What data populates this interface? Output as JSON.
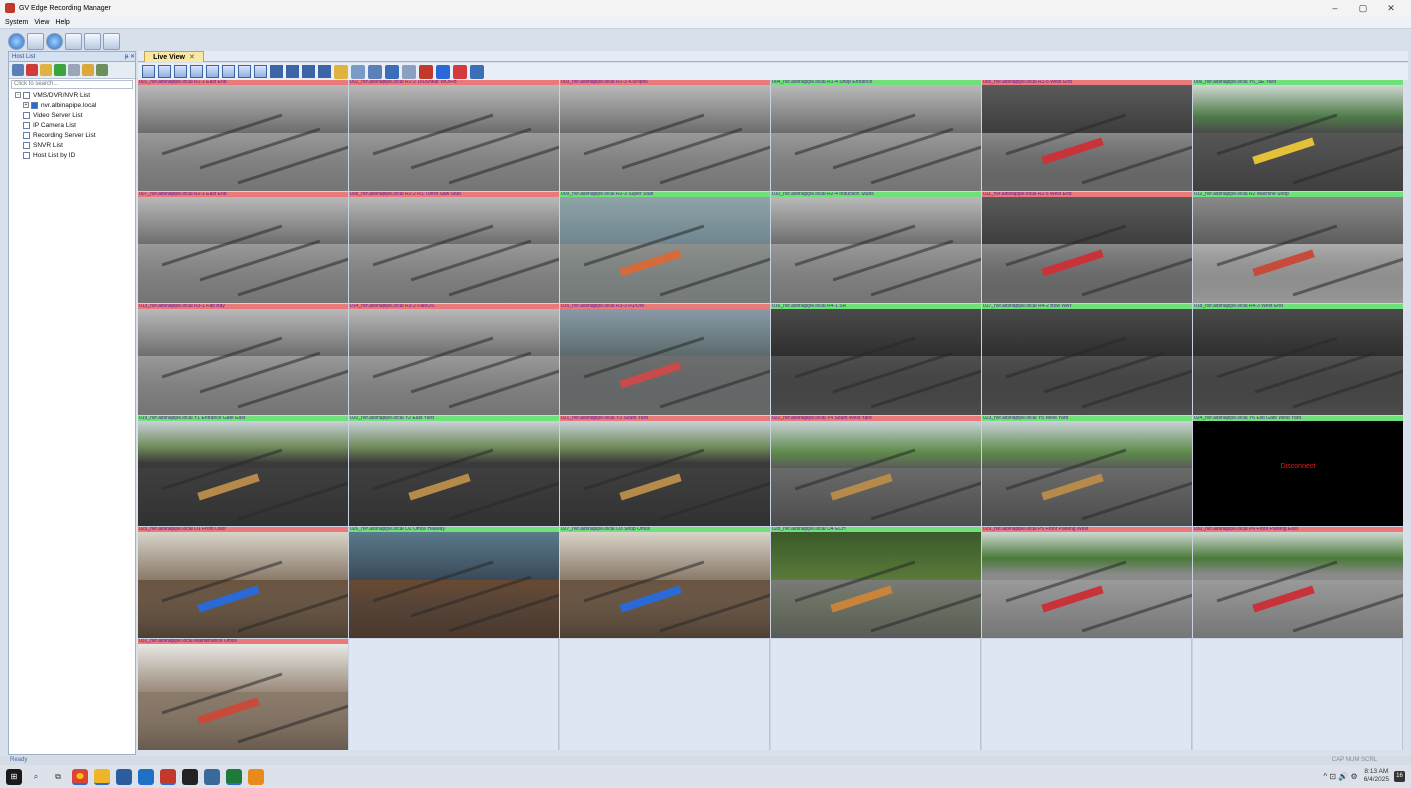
{
  "window": {
    "title": "GV Edge Recording Manager",
    "controls": [
      "–",
      "▢",
      "✕"
    ]
  },
  "menu": [
    {
      "label": "System"
    },
    {
      "label": "View"
    },
    {
      "label": "Help"
    }
  ],
  "host_panel": {
    "title": "Host List",
    "pin": "ᵽ ✕",
    "search_placeholder": "Click to search...",
    "tree": [
      {
        "label": "VMS/DVR/NVR List",
        "level": 0,
        "expand": "-"
      },
      {
        "label": "nvr.albinapipe.local",
        "level": 1,
        "expand": "+"
      },
      {
        "label": "Video Server List",
        "level": 0,
        "expand": ""
      },
      {
        "label": "IP Camera List",
        "level": 0,
        "expand": ""
      },
      {
        "label": "Recording Server List",
        "level": 0,
        "expand": ""
      },
      {
        "label": "SNVR List",
        "level": 0,
        "expand": ""
      },
      {
        "label": "Host List by ID",
        "level": 0,
        "expand": ""
      }
    ]
  },
  "tabs": {
    "live_view": "Live View",
    "close": "✕"
  },
  "cameras": [
    {
      "label": "001_nvr.albinapipe.local R1-1 East End",
      "status": "red",
      "scene": "gray"
    },
    {
      "label": "002_nvr.albinapipe.local R1-2 160Shear WO/FB",
      "status": "red",
      "scene": "gray"
    },
    {
      "label": "003_nvr.albinapipe.local R1-3 4.0Pipes",
      "status": "red",
      "scene": "gray"
    },
    {
      "label": "004_nvr.albinapipe.local R1-4 Shop Entrance",
      "status": "green",
      "scene": "gray"
    },
    {
      "label": "005_nvr.albinapipe.local R1-5 West End",
      "status": "red",
      "scene": "red"
    },
    {
      "label": "006_nvr.albinapipe.local Y6_SE Yard",
      "status": "green",
      "scene": "yard"
    },
    {
      "label": "007_nvr.albinapipe.local R2-1 East End",
      "status": "red",
      "scene": "gray"
    },
    {
      "label": "008_nvr.albinapipe.local R2-2 R1 Turret Saw Stub",
      "status": "red",
      "scene": "gray"
    },
    {
      "label": "009_nvr.albinapipe.local R2-3 Super Stub",
      "status": "green",
      "scene": "blue"
    },
    {
      "label": "010_nvr.albinapipe.local R2-4 Induction Stubs",
      "status": "green",
      "scene": "gray"
    },
    {
      "label": "011_nvr.albinapipe.local R2-5 West End",
      "status": "red",
      "scene": "red"
    },
    {
      "label": "012_nvr.albinapipe.local R2 Machine Shop",
      "status": "green",
      "scene": "shop"
    },
    {
      "label": "013_nvr.albinapipe.local R3-1 Fab Bay",
      "status": "red",
      "scene": "gray"
    },
    {
      "label": "014_nvr.albinapipe.local R3-2 Fab/OS",
      "status": "red",
      "scene": "gray"
    },
    {
      "label": "015_nvr.albinapipe.local R3-3 RJ/OW",
      "status": "red",
      "scene": "colorfab"
    },
    {
      "label": "016_nvr.albinapipe.local R4-1 SR",
      "status": "green",
      "scene": "dark"
    },
    {
      "label": "017_nvr.albinapipe.local R4-2 Bow WAY",
      "status": "green",
      "scene": "dark"
    },
    {
      "label": "018_nvr.albinapipe.local R4-3 West End",
      "status": "green",
      "scene": "dark"
    },
    {
      "label": "019_nvr.albinapipe.local Y1 Entrance Gate East",
      "status": "green",
      "scene": "lot"
    },
    {
      "label": "020_nvr.albinapipe.local Y2 East Yard",
      "status": "green",
      "scene": "lot"
    },
    {
      "label": "021_nvr.albinapipe.local Y3 South Yard",
      "status": "red",
      "scene": "lot"
    },
    {
      "label": "022_nvr.albinapipe.local Y4 South West Yard",
      "status": "red",
      "scene": "lotgreen"
    },
    {
      "label": "023_nvr.albinapipe.local Y5 West Yard",
      "status": "green",
      "scene": "lotgreen"
    },
    {
      "label": "024_nvr.albinapipe.local Y6 Exit Gate West Yard",
      "status": "green",
      "scene": "black",
      "overlay": "Disconnect"
    },
    {
      "label": "025_nvr.albinapipe.local O1 Front Door",
      "status": "red",
      "scene": "office"
    },
    {
      "label": "026_nvr.albinapipe.local O2 Office Hallway",
      "status": "green",
      "scene": "hall"
    },
    {
      "label": "027_nvr.albinapipe.local O3 Shop Office",
      "status": "green",
      "scene": "office"
    },
    {
      "label": "028_nvr.albinapipe.local O4 ECH",
      "status": "green",
      "scene": "garden"
    },
    {
      "label": "029_nvr.albinapipe.local P5 Front Parking West",
      "status": "red",
      "scene": "parking"
    },
    {
      "label": "030_nvr.albinapipe.local P6 Front Parking East",
      "status": "red",
      "scene": "parking"
    },
    {
      "label": "031_nvr.albinapipe.local Maintenance Office",
      "status": "red",
      "scene": "maint"
    }
  ],
  "empty_cells": 5,
  "status": {
    "left": "Ready",
    "right": "CAP NUM SCRL"
  },
  "taskbar": {
    "time": "8:13 AM",
    "date": "6/4/2025",
    "notifications": "16",
    "tray": "^ ⊡ 🔊 ⚙"
  }
}
